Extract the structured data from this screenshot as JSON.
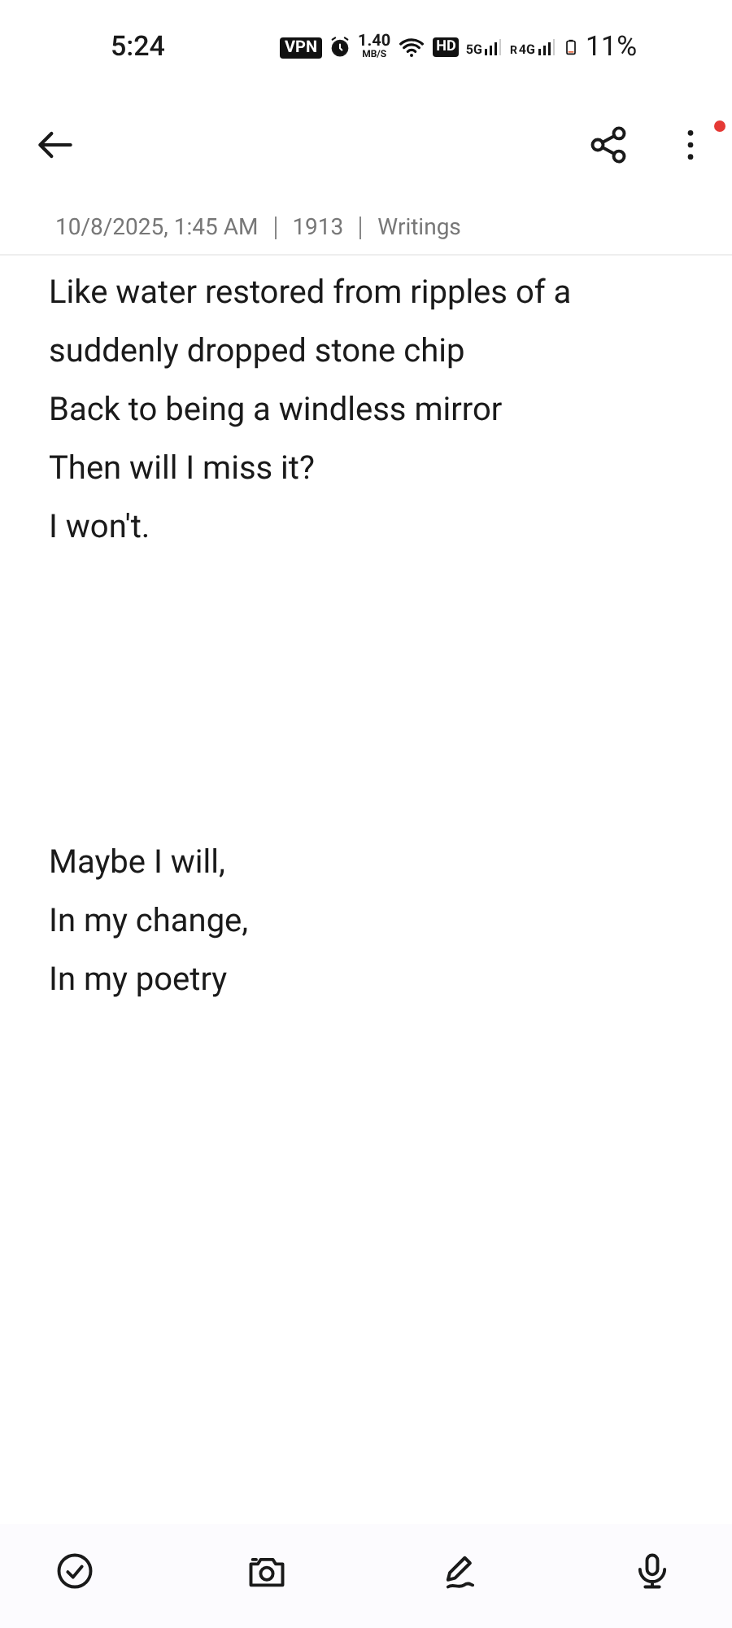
{
  "status_bar": {
    "time": "5:24",
    "vpn": "VPN",
    "speed": "1.40",
    "speed_unit": "MB/S",
    "hd": "HD",
    "network_1": "5G",
    "roaming": "R",
    "network_2": "4G",
    "battery": "11%"
  },
  "toolbar": {
    "more_has_notification": true
  },
  "meta": {
    "date": "10/8/2025, 1:45 AM",
    "count": "1913",
    "folder": "Writings"
  },
  "stanzas": [
    [
      "Like water restored from ripples of a",
      "suddenly dropped stone chip",
      "Back to being a windless mirror",
      "Then will I miss it?",
      "I won't."
    ],
    [
      "Maybe I will,",
      "In my change,",
      "In my poetry"
    ]
  ],
  "bottom_bar": [
    {
      "kind": "checklist"
    },
    {
      "kind": "camera"
    },
    {
      "kind": "draw"
    },
    {
      "kind": "voice"
    }
  ]
}
